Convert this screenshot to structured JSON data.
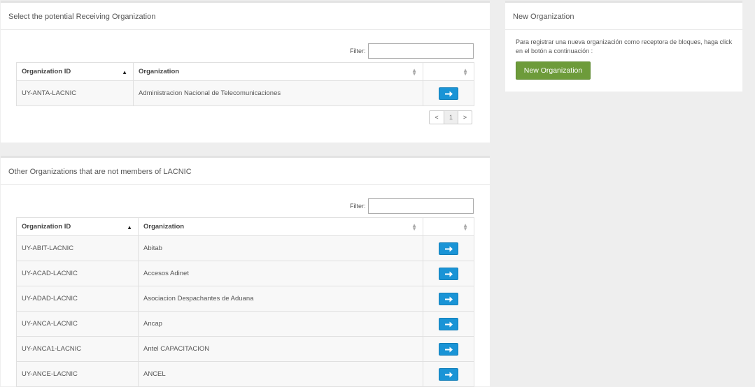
{
  "receiving": {
    "title": "Select the potential Receiving Organization",
    "filter_label": "Filter:",
    "filter_value": "",
    "columns": [
      "Organization ID",
      "Organization"
    ],
    "rows": [
      {
        "id": "UY-ANTA-LACNIC",
        "org": "Administracion Nacional de Telecomunicaciones"
      }
    ],
    "pager": {
      "prev": "<",
      "page": "1",
      "next": ">"
    }
  },
  "others": {
    "title": "Other Organizations that are not members of LACNIC",
    "filter_label": "Filter:",
    "filter_value": "",
    "columns": [
      "Organization ID",
      "Organization"
    ],
    "rows": [
      {
        "id": "UY-ABIT-LACNIC",
        "org": "Abitab"
      },
      {
        "id": "UY-ACAD-LACNIC",
        "org": "Accesos Adinet"
      },
      {
        "id": "UY-ADAD-LACNIC",
        "org": "Asociacion Despachantes de Aduana"
      },
      {
        "id": "UY-ANCA-LACNIC",
        "org": "Ancap"
      },
      {
        "id": "UY-ANCA1-LACNIC",
        "org": "Antel CAPACITACION"
      },
      {
        "id": "UY-ANCE-LACNIC",
        "org": "ANCEL"
      }
    ]
  },
  "new_org": {
    "title": "New Organization",
    "description": "Para registrar una nueva organización como receptora de bloques, haga click en el botón a continuación :",
    "button_label": "New Organization"
  },
  "colors": {
    "select_button": "#1a94d6",
    "new_org_button": "#6d9b3a"
  },
  "icons": {
    "row_action": "arrow-right-icon",
    "sort_asc": "sort-asc-icon",
    "sort_both": "sort-both-icon"
  }
}
